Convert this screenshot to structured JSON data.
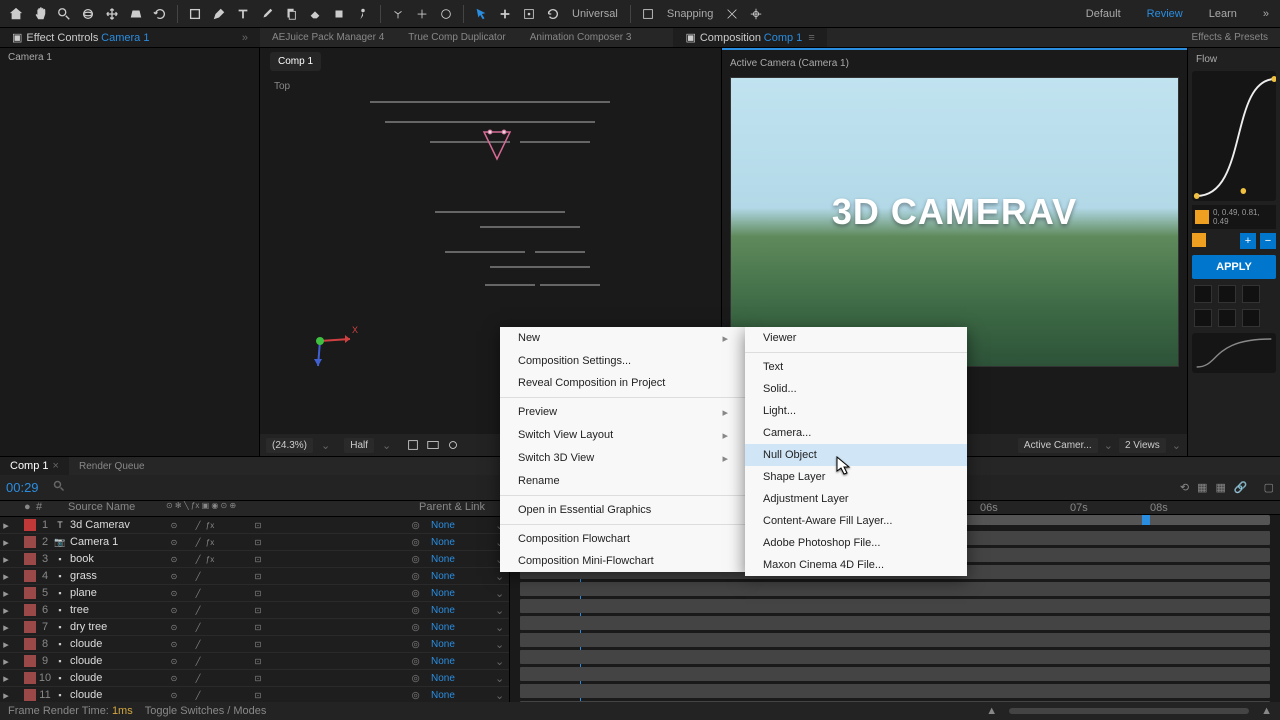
{
  "toolbar": {
    "universal": "Universal",
    "snapping": "Snapping",
    "default": "Default",
    "review": "Review",
    "learn": "Learn"
  },
  "panels": {
    "effect_controls": "Effect Controls",
    "effect_controls_target": "Camera 1",
    "aejuice": "AEJuice Pack Manager 4",
    "true_comp": "True Comp Duplicator",
    "anim_composer": "Animation Composer 3",
    "composition": "Composition",
    "composition_target": "Comp 1",
    "effects_presets": "Effects & Presets",
    "flow": "Flow"
  },
  "left": {
    "camera": "Camera 1"
  },
  "center": {
    "comp_tab": "Comp 1",
    "top_label": "Top"
  },
  "preview": {
    "active_camera": "Active Camera (Camera 1)",
    "text": "3D CAMERAV"
  },
  "viewer_controls": {
    "zoom": "(24.3%)",
    "res": "Half",
    "active_cam": "Active Camer...",
    "views": "2 Views"
  },
  "right": {
    "coords": "0, 0.49, 0.81, 0.49",
    "apply": "APPLY"
  },
  "context": {
    "primary": {
      "new": "New",
      "comp_settings": "Composition Settings...",
      "reveal": "Reveal Composition in Project",
      "preview": "Preview",
      "switch_layout": "Switch View Layout",
      "switch_3d": "Switch 3D View",
      "rename": "Rename",
      "open_essential": "Open in Essential Graphics",
      "flowchart": "Composition Flowchart",
      "mini_flowchart": "Composition Mini-Flowchart"
    },
    "submenu": {
      "viewer": "Viewer",
      "text": "Text",
      "solid": "Solid...",
      "light": "Light...",
      "camera": "Camera...",
      "null_object": "Null Object",
      "shape": "Shape Layer",
      "adjustment": "Adjustment Layer",
      "content_aware": "Content-Aware Fill Layer...",
      "photoshop": "Adobe Photoshop File...",
      "c4d": "Maxon Cinema 4D File..."
    }
  },
  "timeline": {
    "tab_comp": "Comp 1",
    "tab_render": "Render Queue",
    "timecode": "00:29",
    "header": {
      "source_name": "Source Name",
      "parent_link": "Parent & Link"
    },
    "layers": [
      {
        "num": "1",
        "name": "3d Camerav",
        "icon": "T",
        "color": "#c03838",
        "parent": "None"
      },
      {
        "num": "2",
        "name": "Camera 1",
        "icon": "📷",
        "color": "#9a4848",
        "parent": "None"
      },
      {
        "num": "3",
        "name": "book",
        "icon": "▪",
        "color": "#9a4848",
        "parent": "None"
      },
      {
        "num": "4",
        "name": "grass",
        "icon": "▪",
        "color": "#9a4848",
        "parent": "None"
      },
      {
        "num": "5",
        "name": "plane",
        "icon": "▪",
        "color": "#9a4848",
        "parent": "None"
      },
      {
        "num": "6",
        "name": "tree",
        "icon": "▪",
        "color": "#9a4848",
        "parent": "None"
      },
      {
        "num": "7",
        "name": "dry tree",
        "icon": "▪",
        "color": "#9a4848",
        "parent": "None"
      },
      {
        "num": "8",
        "name": "cloude",
        "icon": "▪",
        "color": "#9a4848",
        "parent": "None"
      },
      {
        "num": "9",
        "name": "cloude",
        "icon": "▪",
        "color": "#9a4848",
        "parent": "None"
      },
      {
        "num": "10",
        "name": "cloude",
        "icon": "▪",
        "color": "#9a4848",
        "parent": "None"
      },
      {
        "num": "11",
        "name": "cloude",
        "icon": "▪",
        "color": "#9a4848",
        "parent": "None"
      }
    ],
    "footer": {
      "frame_render": "Frame Render Time:",
      "frame_time": "1ms",
      "toggle": "Toggle Switches / Modes"
    },
    "ruler": {
      "t06": "06s",
      "t07": "07s",
      "t08": "08s"
    },
    "axis_x": "X"
  }
}
